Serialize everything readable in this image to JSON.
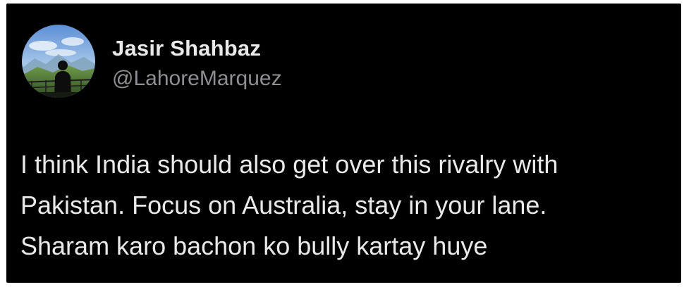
{
  "tweet": {
    "author": {
      "display_name": "Jasir Shahbaz",
      "handle": "@LahoreMarquez",
      "avatar_icon": "profile-photo-mountain-silhouette"
    },
    "text_lines": [
      "I think India should also get over this rivalry with",
      "Pakistan. Focus on Australia, stay in your lane.",
      "Sharam karo bachon ko bully kartay huye"
    ]
  },
  "colors": {
    "background": "#000000",
    "primary_text": "#e9e9ea",
    "secondary_text": "#8e8e93",
    "outer_border": "#ffffff"
  }
}
